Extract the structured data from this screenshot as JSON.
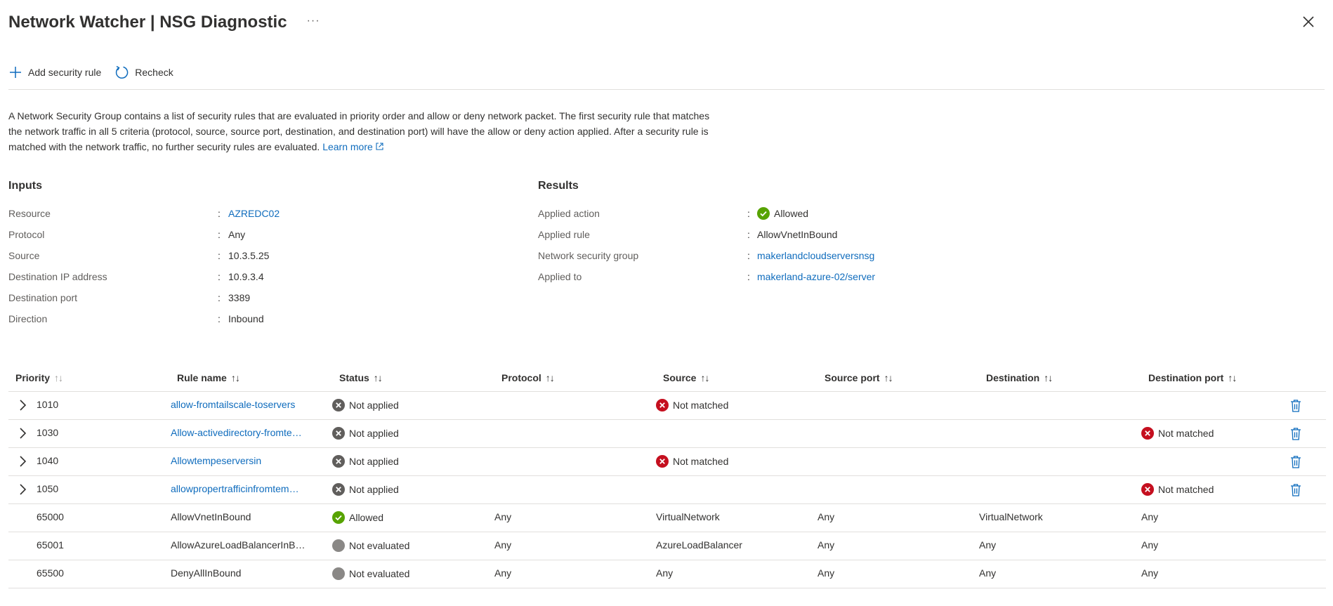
{
  "header": {
    "title": "Network Watcher | NSG Diagnostic",
    "more": "···"
  },
  "toolbar": {
    "add_label": "Add security rule",
    "recheck_label": "Recheck"
  },
  "description": {
    "text": "A Network Security Group contains a list of security rules that are evaluated in priority order and allow or deny network packet. The first security rule that matches the network traffic in all 5 criteria (protocol, source, source port, destination, and destination port) will have the allow or deny action applied. After a security rule is matched with the network traffic, no further security rules are evaluated.",
    "link": "Learn more"
  },
  "inputs": {
    "title": "Inputs",
    "rows": [
      {
        "key": "Resource",
        "value": "AZREDC02"
      },
      {
        "key": "Protocol",
        "value": "Any"
      },
      {
        "key": "Source",
        "value": "10.3.5.25"
      },
      {
        "key": "Destination IP address",
        "value": "10.9.3.4"
      },
      {
        "key": "Destination port",
        "value": "3389"
      },
      {
        "key": "Direction",
        "value": "Inbound"
      }
    ]
  },
  "results": {
    "title": "Results",
    "rows": [
      {
        "key": "Applied action",
        "value": "Allowed"
      },
      {
        "key": "Applied rule",
        "value": "AllowVnetInBound"
      },
      {
        "key": "Network security group",
        "value": "makerlandcloudserversnsg"
      },
      {
        "key": "Applied to",
        "value": "makerland-azure-02/server"
      }
    ]
  },
  "colon": ":",
  "table": {
    "columns": [
      "Priority",
      "Rule name",
      "Status",
      "Protocol",
      "Source",
      "Source port",
      "Destination",
      "Destination port"
    ],
    "rows": [
      {
        "priority": "1010",
        "rule": "allow-fromtailscale-toservers",
        "status": "Not applied",
        "protocol": "",
        "source": "Not matched",
        "source_port": "",
        "destination": "",
        "dest_port": ""
      },
      {
        "priority": "1030",
        "rule": "Allow-activedirectory-fromte…",
        "status": "Not applied",
        "protocol": "",
        "source": "",
        "source_port": "",
        "destination": "",
        "dest_port": "Not matched"
      },
      {
        "priority": "1040",
        "rule": "Allowtempeserversin",
        "status": "Not applied",
        "protocol": "",
        "source": "Not matched",
        "source_port": "",
        "destination": "",
        "dest_port": ""
      },
      {
        "priority": "1050",
        "rule": "allowpropertrafficinfromtem…",
        "status": "Not applied",
        "protocol": "",
        "source": "",
        "source_port": "",
        "destination": "",
        "dest_port": "Not matched"
      },
      {
        "priority": "65000",
        "rule": "AllowVnetInBound",
        "status": "Allowed",
        "protocol": "Any",
        "source": "VirtualNetwork",
        "source_port": "Any",
        "destination": "VirtualNetwork",
        "dest_port": "Any"
      },
      {
        "priority": "65001",
        "rule": "AllowAzureLoadBalancerInB…",
        "status": "Not evaluated",
        "protocol": "Any",
        "source": "AzureLoadBalancer",
        "source_port": "Any",
        "destination": "Any",
        "dest_port": "Any"
      },
      {
        "priority": "65500",
        "rule": "DenyAllInBound",
        "status": "Not evaluated",
        "protocol": "Any",
        "source": "Any",
        "source_port": "Any",
        "destination": "Any",
        "dest_port": "Any"
      }
    ]
  },
  "colors": {
    "link": "#0f6cbd",
    "success": "#57a300",
    "error": "#c50f1f",
    "neutral": "#605e5c",
    "grey": "#8a8886"
  }
}
